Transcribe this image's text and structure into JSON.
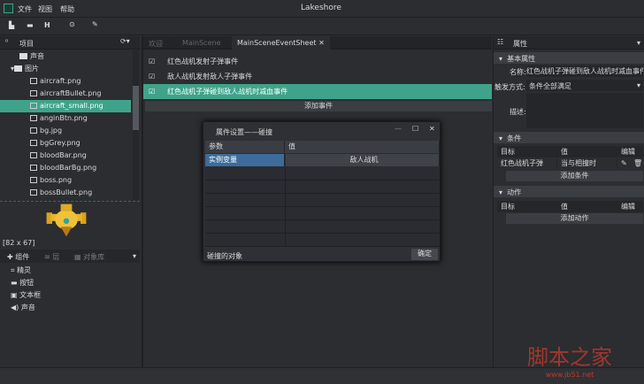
{
  "app": {
    "title": "Lakeshore",
    "menu": [
      "文件",
      "视图",
      "帮助"
    ]
  },
  "left": {
    "panel_title": "项目",
    "tree": [
      {
        "label": "声音",
        "type": "folder"
      },
      {
        "label": "图片",
        "type": "folder-open"
      },
      {
        "label": "aircraft.png"
      },
      {
        "label": "aircraftBullet.png"
      },
      {
        "label": "aircraft_small.png",
        "selected": true
      },
      {
        "label": "anginBtn.png"
      },
      {
        "label": "bg.jpg"
      },
      {
        "label": "bgGrey.png"
      },
      {
        "label": "bloodBar.png"
      },
      {
        "label": "bloodBarBg.png"
      },
      {
        "label": "boss.png"
      },
      {
        "label": "bossBullet.png"
      }
    ],
    "preview_size": "[82 x 67]",
    "comp_tabs": [
      "组件",
      "层",
      "对象库"
    ],
    "components": [
      "精灵",
      "按钮",
      "文本框",
      "声音"
    ]
  },
  "center": {
    "tabs": [
      "欢迎",
      "MainScene",
      "MainSceneEventSheet"
    ],
    "events": [
      "红色战机发射子弹事件",
      "敌人战机发射敌人子弹事件",
      "红色战机子弹碰到敌人战机时减血事件"
    ],
    "add_event": "添加事件"
  },
  "dialog": {
    "title": "属件设置——碰撞",
    "col_param": "参数",
    "col_value": "值",
    "param": "实例变量",
    "value": "敌人战机",
    "footer_label": "碰撞的对象",
    "ok": "确定"
  },
  "right": {
    "panel_title": "属性",
    "basic": "基本属性",
    "name_label": "名称:",
    "name_value": "红色战机子弹碰到敌人战机时减血事件",
    "trigger_label": "触发方式:",
    "trigger_value": "条件全部满足",
    "desc_label": "描述:",
    "cond_title": "条件",
    "cols": [
      "目标",
      "值",
      "编辑"
    ],
    "cond_target": "红色战机子弹",
    "cond_value": "当与相撞时",
    "add_cond": "添加条件",
    "action_title": "动作",
    "add_action": "添加动作"
  },
  "watermark": {
    "text": "脚本之家",
    "url": "www.jb51.net"
  },
  "colors": {
    "accent": "#3ea38a",
    "select_blue": "#3d6c9a"
  }
}
